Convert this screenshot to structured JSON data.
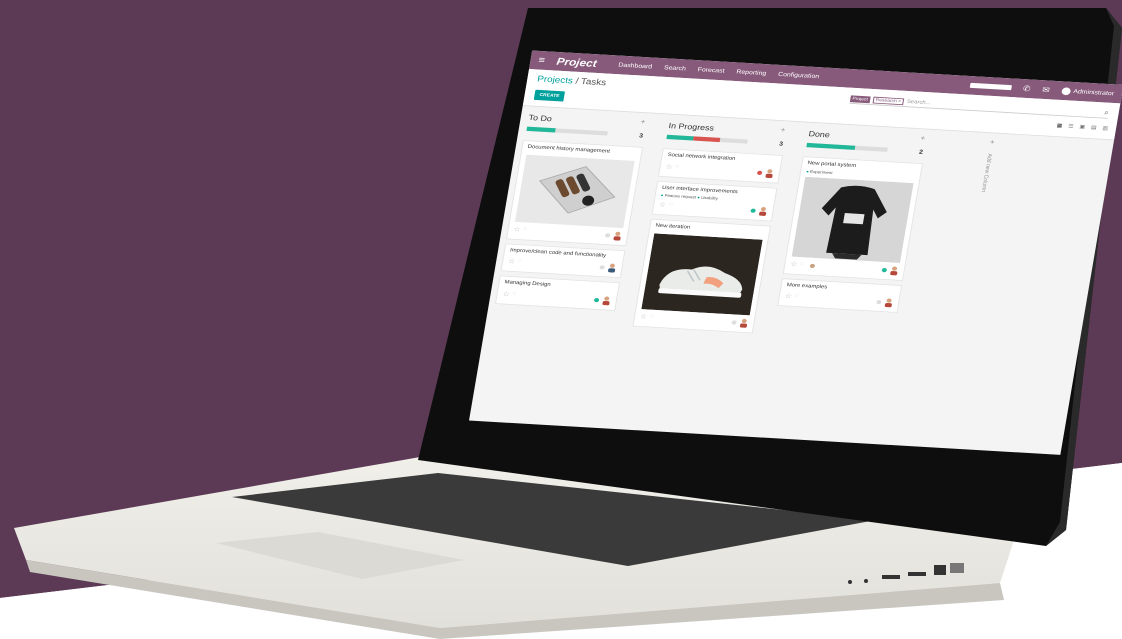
{
  "colors": {
    "backdrop_purple": "#5c3a55",
    "brand": "#875a7b",
    "accent": "#00a09d",
    "status_green": "#21b799",
    "status_red": "#d9534f"
  },
  "navbar": {
    "menu_icon": "hamburger-icon",
    "app_title": "Project",
    "items": [
      "Dashboard",
      "Search",
      "Forecast",
      "Reporting",
      "Configuration"
    ],
    "user_name": "Administrator"
  },
  "control": {
    "breadcrumb_parent": "Projects",
    "breadcrumb_sep": " / ",
    "breadcrumb_current": "Tasks",
    "create_label": "CREATE",
    "search_facet": "Project",
    "search_facet_value": "Research ×",
    "search_placeholder": "Search..."
  },
  "columns": [
    {
      "title": "To Do",
      "count": "3",
      "progress": {
        "green": 0.35,
        "red": 0
      },
      "cards": [
        {
          "title": "Document history management",
          "image": "tray-photo",
          "status": "grey"
        },
        {
          "title": "Improve/clean code and functionality",
          "status": "grey"
        },
        {
          "title": "Managing Design",
          "status": "green"
        }
      ]
    },
    {
      "title": "In Progress",
      "count": "3",
      "progress": {
        "green": 0.33,
        "red": 0.33
      },
      "cards": [
        {
          "title": "Social network integration",
          "status": "red"
        },
        {
          "title": "User interface improvements",
          "tags": [
            "Feature request",
            "Usability"
          ],
          "status": "green"
        },
        {
          "title": "New iteration",
          "image": "sneaker-photo",
          "status": "grey"
        }
      ]
    },
    {
      "title": "Done",
      "count": "2",
      "progress": {
        "green": 0.6,
        "red": 0
      },
      "cards": [
        {
          "title": "New portal system",
          "tags": [
            "Experiment"
          ],
          "image": "sweatshirt-photo",
          "status": "green"
        },
        {
          "title": "More examples",
          "status": "grey"
        }
      ]
    }
  ],
  "add_column_label": "Add new Column"
}
